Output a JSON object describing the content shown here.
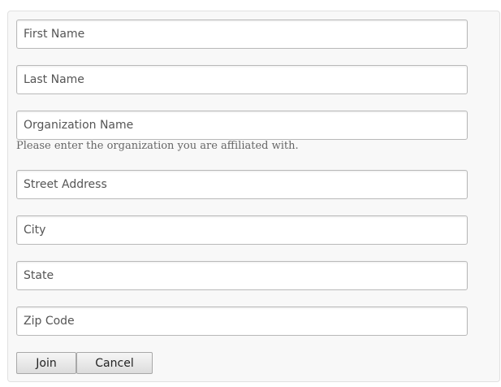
{
  "form": {
    "fields": {
      "first_name": {
        "placeholder": "First Name",
        "value": ""
      },
      "last_name": {
        "placeholder": "Last Name",
        "value": ""
      },
      "organization": {
        "placeholder": "Organization Name",
        "value": ""
      },
      "street": {
        "placeholder": "Street Address",
        "value": ""
      },
      "city": {
        "placeholder": "City",
        "value": ""
      },
      "state": {
        "placeholder": "State",
        "value": ""
      },
      "zip": {
        "placeholder": "Zip Code",
        "value": ""
      }
    },
    "organization_help": "Please enter the organization you are affiliated with.",
    "join_label": "Join",
    "cancel_label": "Cancel"
  }
}
